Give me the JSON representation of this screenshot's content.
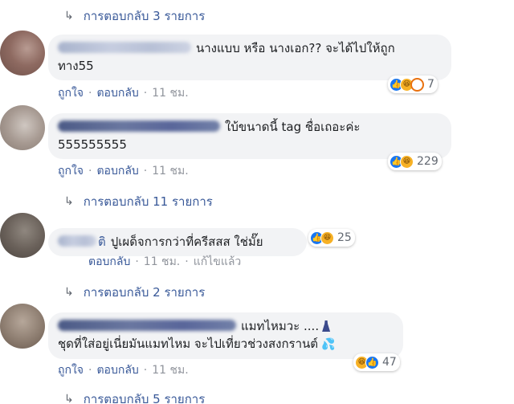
{
  "reply_links": [
    {
      "label": "การตอบกลับ 3 รายการ"
    },
    {
      "label": "การตอบกลับ 11 รายการ"
    },
    {
      "label": "การตอบกลับ 2 รายการ"
    },
    {
      "label": "การตอบกลับ 5 รายการ"
    }
  ],
  "comments": [
    {
      "text_line1": "นางแบบ หรือ นางเอก?? จะได้ไปให้ถูก",
      "text_line2": "ทาง55",
      "reaction_count": "7",
      "actions": {
        "like": "ถูกใจ",
        "reply": "ตอบกลับ",
        "time": "11 ชม."
      }
    },
    {
      "text_line1": "ใบ้ขนาดนี้ tag ชื่อเถอะค่ะ",
      "text_line2": "555555555",
      "reaction_count": "229",
      "actions": {
        "like": "ถูกใจ",
        "reply": "ตอบกลับ",
        "time": "11 ชม."
      }
    },
    {
      "name_suffix": "ติ",
      "text_line1": "ปูเผด็จการกว่าที่ครีสสส ใช่มั๊ย",
      "reaction_count": "25",
      "actions": {
        "reply": "ตอบกลับ",
        "time": "11 ชม.",
        "edited": "แก้ไขแล้ว"
      }
    },
    {
      "text_line1": "แมทไหมวะ ....",
      "text_line2": "ชุดที่ใส่อยู่เนี่ยมันแมทไหม จะไปเที่ยวช่วงสงกรานต์",
      "reaction_count": "47",
      "actions": {
        "like": "ถูกใจ",
        "reply": "ตอบกลับ",
        "time": "11 ชม."
      }
    }
  ],
  "icons": {
    "like": "like-icon",
    "haha": "haha-icon",
    "angry": "angry-icon",
    "reply_arrow": "reply-arrow-icon",
    "dress": "dress-emoji-icon",
    "drops": "sweat-drops-emoji-icon"
  },
  "colors": {
    "link": "#385898",
    "bubble": "#f2f3f5",
    "like": "#1877f2",
    "haha": "#f7b125",
    "angry": "#e9710f",
    "meta": "#90949c"
  }
}
